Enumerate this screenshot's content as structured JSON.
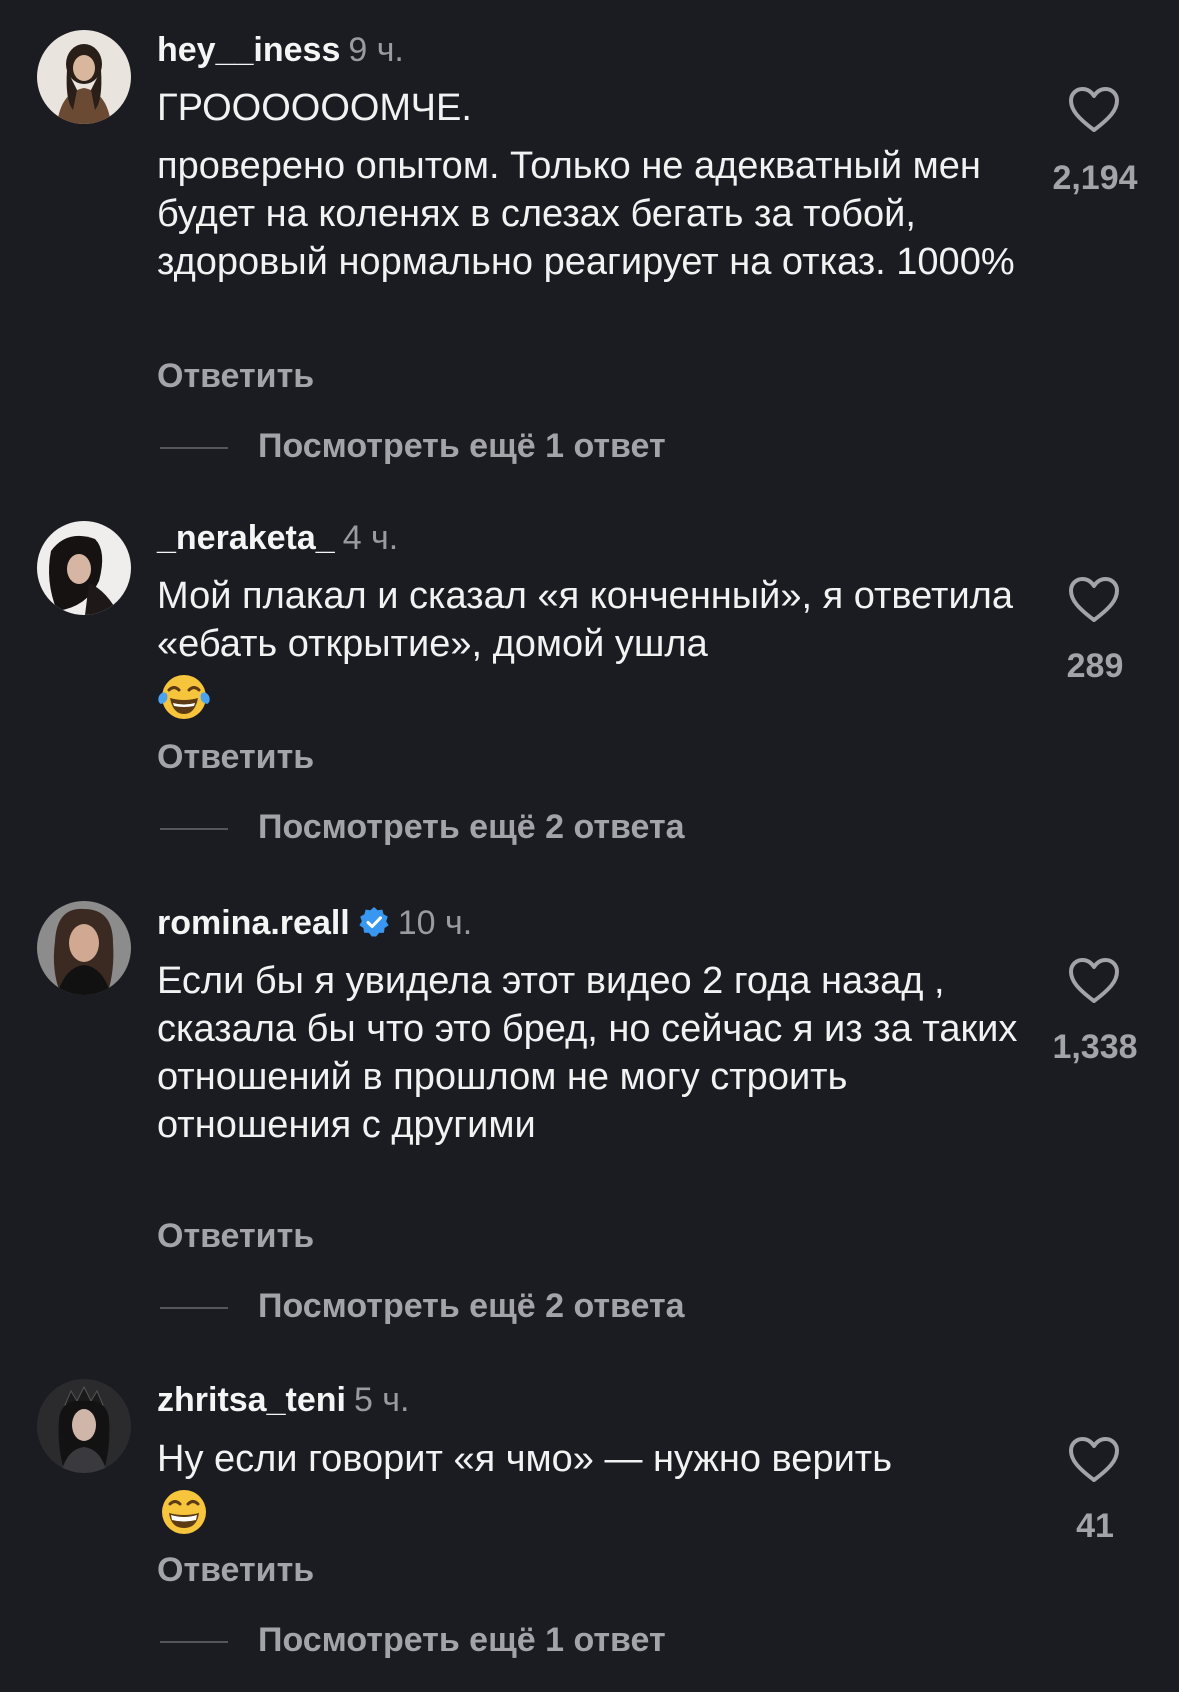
{
  "comments": [
    {
      "username": "hey__iness",
      "time": "9 ч.",
      "verified": false,
      "paragraphs": [
        "ГРООООООМЧЕ.",
        "проверено опытом. Только не адекватный мен будет на коленях в слезах бегать за тобой, здоровый нормально реагирует на отказ. 1000%"
      ],
      "reply_label": "Ответить",
      "view_more_label": "Посмотреть ещё 1 ответ",
      "likes": "2,194",
      "avatar_icon": "avatar-photo-icon"
    },
    {
      "username": "_neraketa_",
      "time": "4 ч.",
      "verified": false,
      "paragraphs": [
        "Мой плакал и сказал «я конченный», я ответила «ебать открытие», домой ушла"
      ],
      "emoji": "laughing-with-tears-emoji",
      "reply_label": "Ответить",
      "view_more_label": "Посмотреть ещё 2 ответа",
      "likes": "289",
      "avatar_icon": "avatar-photo-icon"
    },
    {
      "username": "romina.reall",
      "time": "10 ч.",
      "verified": true,
      "paragraphs": [
        "Если бы я увидела этот видео 2 года назад , сказала бы что это бред, но сейчас я из за таких отношений в прошлом не могу строить отношения с другими"
      ],
      "reply_label": "Ответить",
      "view_more_label": "Посмотреть ещё 2 ответа",
      "likes": "1,338",
      "avatar_icon": "avatar-photo-icon"
    },
    {
      "username": "zhritsa_teni",
      "time": "5 ч.",
      "verified": false,
      "paragraphs": [
        "Ну если говорит «я чмо» — нужно верить"
      ],
      "emoji": "grinning-face-emoji",
      "reply_label": "Ответить",
      "view_more_label": "Посмотреть ещё 1 ответ",
      "likes": "41",
      "avatar_icon": "avatar-photo-icon"
    }
  ],
  "colors": {
    "background": "#1b1c21",
    "text": "#f2f2f2",
    "secondary_text": "#a3a3a8",
    "verified_badge": "#3897f0"
  },
  "icons": {
    "like": "heart-outline-icon",
    "verified": "verified-badge-icon"
  }
}
